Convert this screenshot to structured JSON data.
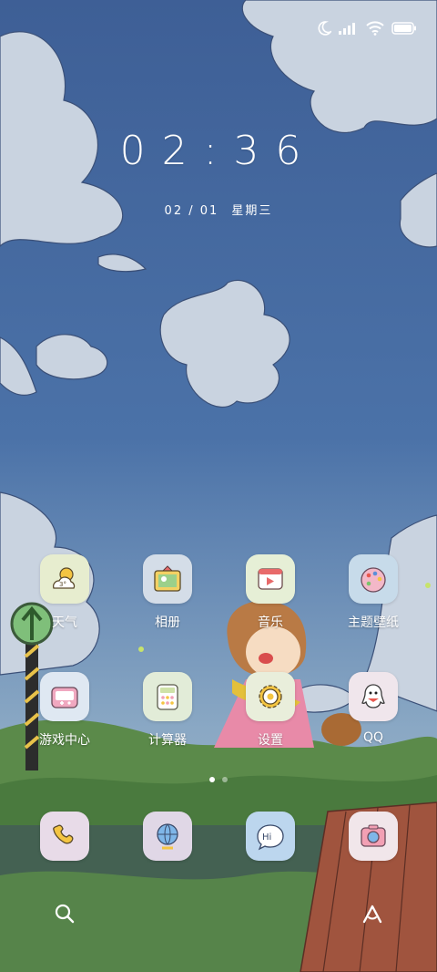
{
  "status_bar": {
    "icons": [
      "moon-icon",
      "signal-icon",
      "wifi-icon",
      "battery-icon"
    ]
  },
  "clock": {
    "time": "02:36"
  },
  "date": {
    "month_day": "02 / 01",
    "weekday": "星期三"
  },
  "apps": [
    {
      "label": "天气",
      "icon": "weather-icon"
    },
    {
      "label": "相册",
      "icon": "gallery-icon"
    },
    {
      "label": "音乐",
      "icon": "music-icon"
    },
    {
      "label": "主题壁纸",
      "icon": "themes-icon"
    },
    {
      "label": "游戏中心",
      "icon": "game-center-icon"
    },
    {
      "label": "计算器",
      "icon": "calculator-icon"
    },
    {
      "label": "设置",
      "icon": "settings-icon"
    },
    {
      "label": "QQ",
      "icon": "qq-icon"
    }
  ],
  "dock": [
    {
      "icon": "phone-icon"
    },
    {
      "icon": "browser-icon"
    },
    {
      "icon": "messages-icon"
    },
    {
      "icon": "camera-icon"
    }
  ],
  "bottom_bar": {
    "icons": [
      "search-icon",
      "assistant-icon"
    ]
  },
  "page_indicator": {
    "pages": 2,
    "active": 0
  }
}
